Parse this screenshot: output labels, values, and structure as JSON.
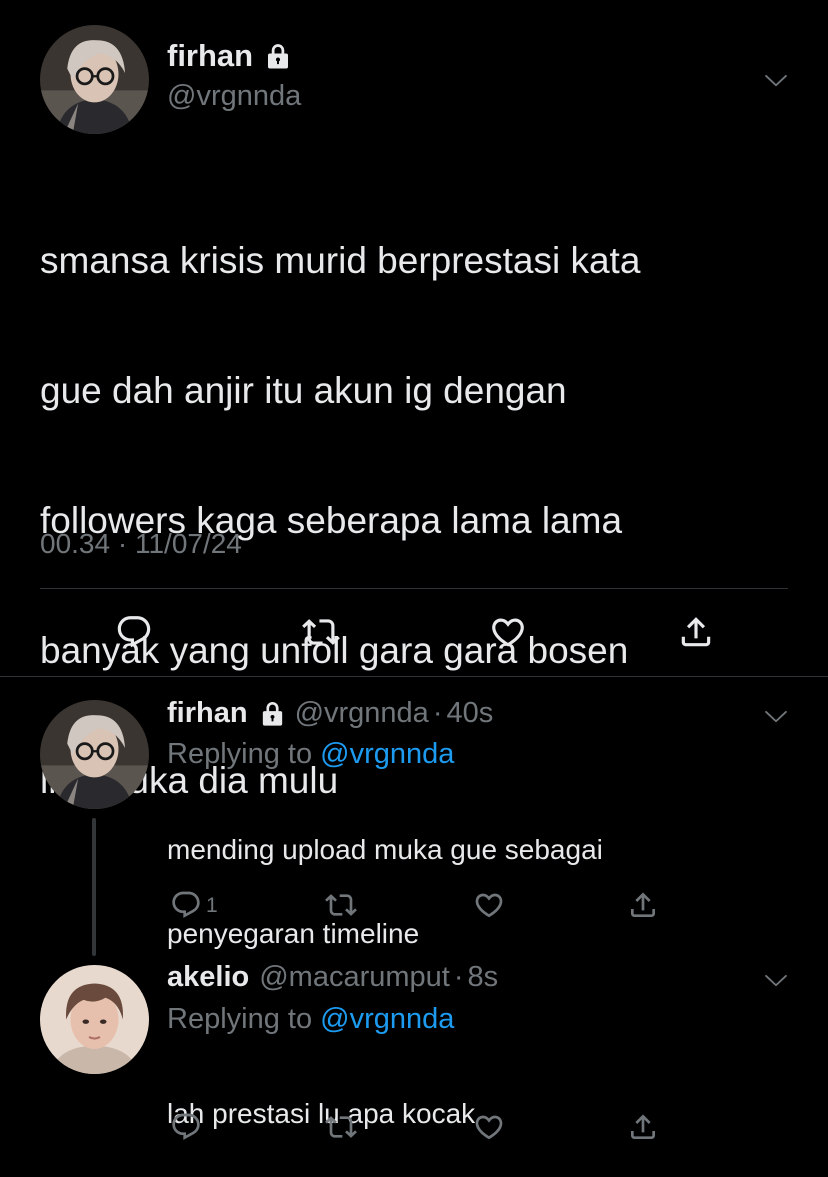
{
  "main_tweet": {
    "display_name": "firhan",
    "handle": "@vrgnnda",
    "lines": [
      "smansa krisis murid berprestasi kata",
      "gue dah anjir itu akun ig dengan",
      "followers kaga seberapa lama lama",
      "banyak yang unfoll gara gara bosen",
      "liat muka dia mulu"
    ],
    "time": "00.34",
    "separator": "·",
    "date": "11/07/24"
  },
  "replies": [
    {
      "display_name": "firhan",
      "handle": "@vrgnnda",
      "separator": "·",
      "age": "40s",
      "replying_prefix": "Replying to",
      "replying_to": "@vrgnnda",
      "lines": [
        "mending upload muka gue sebagai",
        "penyegaran timeline"
      ],
      "reply_count": "1"
    },
    {
      "display_name": "akelio",
      "handle": "@macarumput",
      "separator": "·",
      "age": "8s",
      "replying_prefix": "Replying to",
      "replying_to": "@vrgnnda",
      "lines": [
        "lah prestasi lu apa kocak"
      ],
      "reply_count": ""
    }
  ],
  "icons": {
    "lock": "lock-icon",
    "caret": "chevron-down-icon",
    "reply": "reply-icon",
    "retweet": "retweet-icon",
    "like": "heart-icon",
    "share": "share-icon"
  },
  "colors": {
    "background": "#000000",
    "text": "#e7e9ea",
    "muted": "#71767b",
    "link": "#1d9bf0",
    "divider": "#2f3336"
  }
}
